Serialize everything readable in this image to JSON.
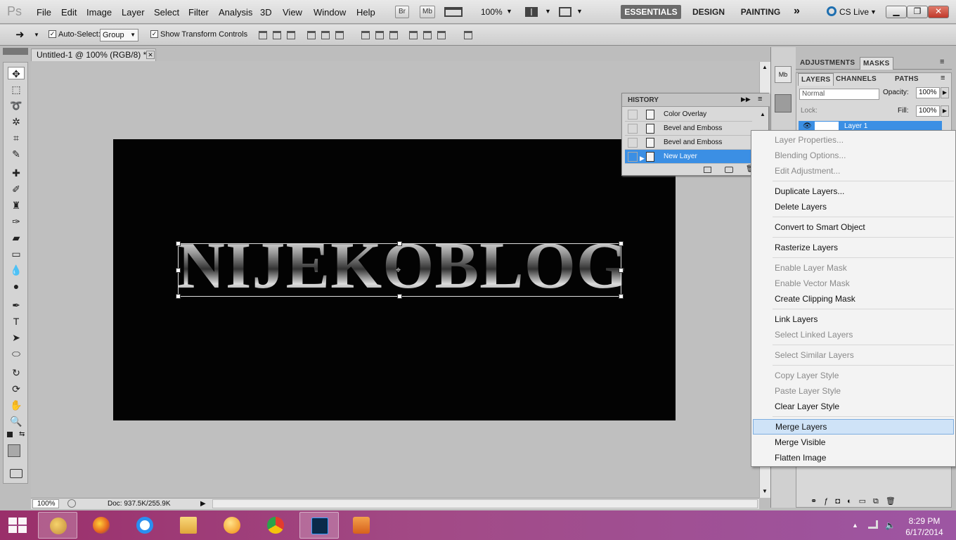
{
  "app": {
    "logo": "Ps",
    "zoom_display": "100%",
    "cs_live": "CS Live"
  },
  "menu": [
    "File",
    "Edit",
    "Image",
    "Layer",
    "Select",
    "Filter",
    "Analysis",
    "3D",
    "View",
    "Window",
    "Help"
  ],
  "mini_buttons": [
    "Br",
    "Mb"
  ],
  "workspaces": [
    "ESSENTIALS",
    "DESIGN",
    "PAINTING"
  ],
  "options": {
    "auto_select_label": "Auto-Select:",
    "auto_select_value": "Group",
    "transform_label": "Show Transform Controls"
  },
  "document": {
    "tab_title": "Untitled-1 @ 100% (RGB/8) *",
    "canvas_text": "NIJEKOBLOG",
    "status_zoom": "100%",
    "status_doc": "Doc: 937.5K/255.9K"
  },
  "history": {
    "title": "HISTORY",
    "items": [
      "Color Overlay",
      "Bevel and Emboss",
      "Bevel and Emboss",
      "New Layer"
    ]
  },
  "panels": {
    "top_tabs": [
      "ADJUSTMENTS",
      "MASKS"
    ],
    "layer_tabs": [
      "LAYERS",
      "CHANNELS",
      "PATHS"
    ],
    "blend_mode": "Normal",
    "opacity_label": "Opacity:",
    "opacity_value": "100%",
    "lock_label": "Lock:",
    "fill_label": "Fill:",
    "fill_value": "100%",
    "layer_name": "Layer 1"
  },
  "context_menu": [
    {
      "label": "Layer Properties...",
      "enabled": false
    },
    {
      "label": "Blending Options...",
      "enabled": false
    },
    {
      "label": "Edit Adjustment...",
      "enabled": false
    },
    {
      "label": "Duplicate Layers...",
      "enabled": true
    },
    {
      "label": "Delete Layers",
      "enabled": true
    },
    {
      "label": "Convert to Smart Object",
      "enabled": true
    },
    {
      "label": "Rasterize Layers",
      "enabled": true
    },
    {
      "label": "Enable Layer Mask",
      "enabled": false
    },
    {
      "label": "Enable Vector Mask",
      "enabled": false
    },
    {
      "label": "Create Clipping Mask",
      "enabled": true
    },
    {
      "label": "Link Layers",
      "enabled": true
    },
    {
      "label": "Select Linked Layers",
      "enabled": false
    },
    {
      "label": "Select Similar Layers",
      "enabled": false
    },
    {
      "label": "Copy Layer Style",
      "enabled": false
    },
    {
      "label": "Paste Layer Style",
      "enabled": false
    },
    {
      "label": "Clear Layer Style",
      "enabled": true
    },
    {
      "label": "Merge Layers",
      "enabled": true,
      "highlighted": true
    },
    {
      "label": "Merge Visible",
      "enabled": true
    },
    {
      "label": "Flatten Image",
      "enabled": true
    }
  ],
  "taskbar": {
    "time": "8:29 PM",
    "date": "6/17/2014",
    "apps": [
      "paint-app",
      "firefox",
      "internet-explorer",
      "file-explorer",
      "media-app",
      "chrome",
      "photoshop",
      "video-player"
    ],
    "active_app": "photoshop"
  },
  "colors": {
    "accent_selection": "#3b8fe4",
    "menu_highlight": "#cfe3f7",
    "taskbar": "#a24a86",
    "canvas": "#030303"
  }
}
